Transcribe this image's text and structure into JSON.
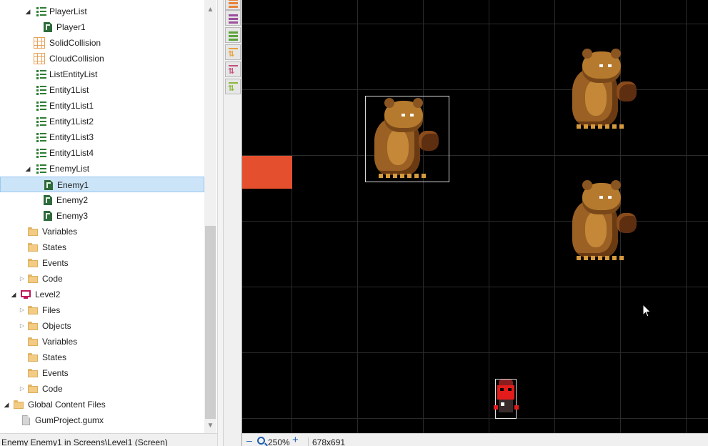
{
  "tree": {
    "items": [
      {
        "label": "PlayerList",
        "icon": "list-icon",
        "expander": "open"
      },
      {
        "label": "Player1",
        "icon": "entity-icon",
        "expander": "none"
      },
      {
        "label": "SolidCollision",
        "icon": "collision-grid-icon",
        "expander": "none"
      },
      {
        "label": "CloudCollision",
        "icon": "collision-grid-icon",
        "expander": "none"
      },
      {
        "label": "ListEntityList",
        "icon": "list-icon",
        "expander": "none"
      },
      {
        "label": "Entity1List",
        "icon": "list-icon",
        "expander": "none"
      },
      {
        "label": "Entity1List1",
        "icon": "list-icon",
        "expander": "none"
      },
      {
        "label": "Entity1List2",
        "icon": "list-icon",
        "expander": "none"
      },
      {
        "label": "Entity1List3",
        "icon": "list-icon",
        "expander": "none"
      },
      {
        "label": "Entity1List4",
        "icon": "list-icon",
        "expander": "none"
      },
      {
        "label": "EnemyList",
        "icon": "list-icon",
        "expander": "open"
      },
      {
        "label": "Enemy1",
        "icon": "entity-icon",
        "expander": "none",
        "selected": true
      },
      {
        "label": "Enemy2",
        "icon": "entity-icon",
        "expander": "none"
      },
      {
        "label": "Enemy3",
        "icon": "entity-icon",
        "expander": "none"
      },
      {
        "label": "Variables",
        "icon": "folder-icon",
        "expander": "none"
      },
      {
        "label": "States",
        "icon": "folder-icon",
        "expander": "none"
      },
      {
        "label": "Events",
        "icon": "folder-icon",
        "expander": "none"
      },
      {
        "label": "Code",
        "icon": "folder-icon",
        "expander": "closed"
      },
      {
        "label": "Level2",
        "icon": "screen-icon",
        "expander": "open"
      },
      {
        "label": "Files",
        "icon": "folder-icon",
        "expander": "closed"
      },
      {
        "label": "Objects",
        "icon": "folder-icon",
        "expander": "closed"
      },
      {
        "label": "Variables",
        "icon": "folder-icon",
        "expander": "none"
      },
      {
        "label": "States",
        "icon": "folder-icon",
        "expander": "none"
      },
      {
        "label": "Events",
        "icon": "folder-icon",
        "expander": "none"
      },
      {
        "label": "Code",
        "icon": "folder-icon",
        "expander": "closed"
      },
      {
        "label": "Global Content Files",
        "icon": "folder-icon",
        "expander": "open"
      },
      {
        "label": "GumProject.gumx",
        "icon": "file-icon",
        "expander": "none"
      }
    ]
  },
  "status": {
    "text": "Enemy Enemy1 in Screens\\Level1 (Screen)"
  },
  "toolbar": {
    "buttons": [
      {
        "name": "layer-orange-icon",
        "color": "#e8823a"
      },
      {
        "name": "layer-purple-icon",
        "color": "#9b4f9e"
      },
      {
        "name": "layer-green-icon",
        "color": "#5aa43a"
      },
      {
        "name": "move-up-orange-icon",
        "color": "#e8a23a"
      },
      {
        "name": "move-down-pink-icon",
        "color": "#c2507a"
      },
      {
        "name": "move-green-icon",
        "color": "#8ab83a"
      }
    ]
  },
  "canvas": {
    "zoom": "250%",
    "size": "678x691",
    "background": "#000000",
    "accent_block_color": "#e4502e"
  }
}
